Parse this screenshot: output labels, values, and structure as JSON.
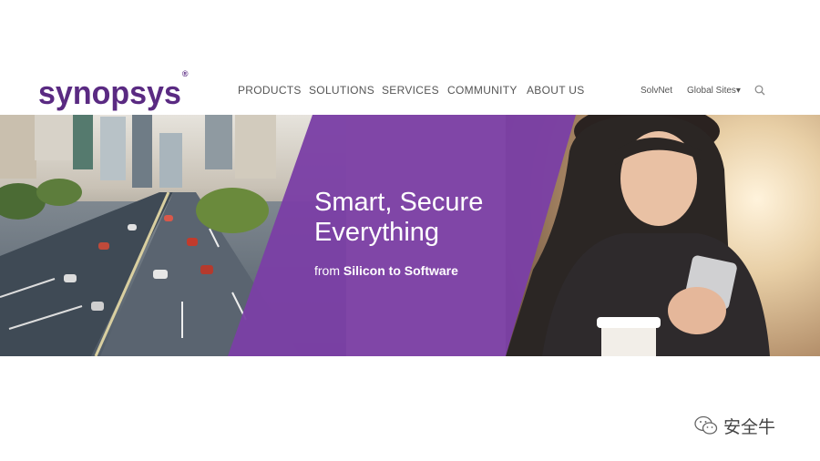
{
  "brand": {
    "logo_text": "synopsys",
    "logo_mark": "®",
    "color": "#5a2a82"
  },
  "nav": {
    "items": [
      {
        "label": "PRODUCTS"
      },
      {
        "label": "SOLUTIONS"
      },
      {
        "label": "SERVICES"
      },
      {
        "label": "COMMUNITY"
      },
      {
        "label": "ABOUT US"
      }
    ],
    "utility": {
      "solvnet": "SolvNet",
      "global_sites": "Global Sites▾"
    },
    "search_icon": "search-icon"
  },
  "hero": {
    "title_line1": "Smart, Secure",
    "title_line2": "Everything",
    "subtitle_prefix": "from ",
    "subtitle_bold": "Silicon to Software",
    "panel_color": "#7d3fa8"
  },
  "watermark": {
    "text": "安全牛",
    "icon": "wechat-icon"
  }
}
